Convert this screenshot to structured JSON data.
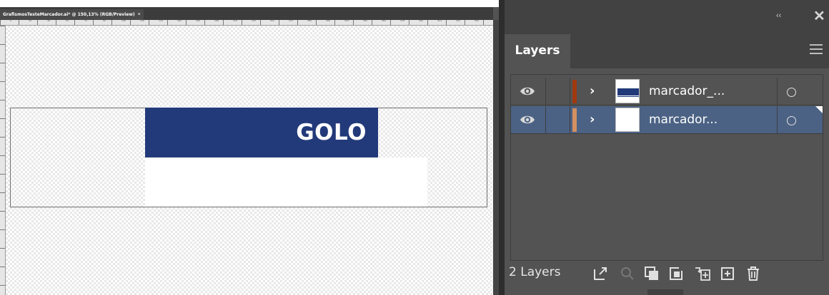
{
  "document": {
    "tab_title": "GrafismosTesteMarcador.ai* @ 150,13% (RGB/Preview)",
    "tab_close": "×",
    "ruler_marks": [
      "0",
      "18",
      "36",
      "54",
      "72",
      "90",
      "108",
      "126",
      "144",
      "162",
      "180",
      "198",
      "216",
      "234",
      "252",
      "270",
      "288",
      "306",
      "324",
      "342",
      "360",
      "378",
      "396",
      "414",
      "432",
      "450"
    ],
    "artwork": {
      "banner_text": "GOLO",
      "banner_color": "#223a7a"
    }
  },
  "panel": {
    "collapse_glyph": "‹‹",
    "close_glyph": "✕",
    "tab_label": "Layers",
    "layers": [
      {
        "name": "marcador_...",
        "color": "#a0380f",
        "thumbnail": "banner"
      },
      {
        "name": "marcador...",
        "color": "#d39060",
        "thumbnail": "blank"
      }
    ],
    "footer": {
      "count_label": "2 Layers",
      "buttons": [
        "export-icon",
        "locate-object-icon",
        "clipping-mask-icon",
        "new-sublayer-icon",
        "collect-in-new-layer-icon",
        "new-layer-icon",
        "trash-icon"
      ]
    }
  },
  "colors": {
    "selection": "#4b6284",
    "panel_bg": "#535353"
  }
}
